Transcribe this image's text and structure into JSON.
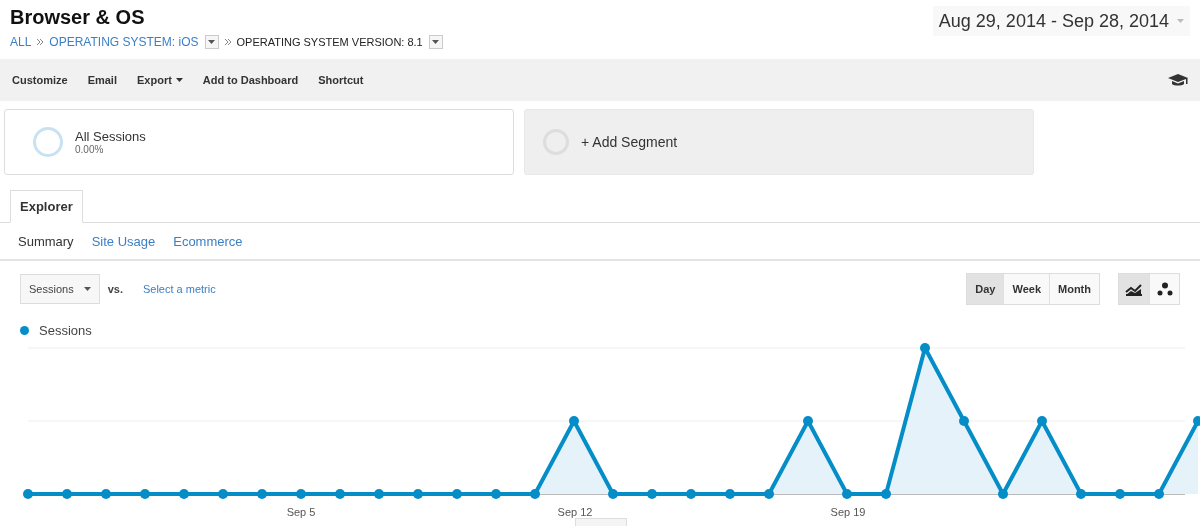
{
  "title": "Browser & OS",
  "date_range": "Aug 29, 2014 - Sep 28, 2014",
  "breadcrumb": [
    {
      "label": "ALL",
      "kind": "link"
    },
    {
      "label": "OPERATING SYSTEM: iOS",
      "kind": "dropdown"
    },
    {
      "label": "OPERATING SYSTEM VERSION: 8.1",
      "kind": "dropdown-current"
    }
  ],
  "toolbar": [
    {
      "label": "Customize",
      "menu": false
    },
    {
      "label": "Email",
      "menu": false
    },
    {
      "label": "Export",
      "menu": true
    },
    {
      "label": "Add to Dashboard",
      "menu": false
    },
    {
      "label": "Shortcut",
      "menu": false
    }
  ],
  "segments": [
    {
      "name": "All Sessions",
      "detail": "0.00%",
      "kind": "active"
    },
    {
      "name": "+ Add Segment",
      "kind": "add"
    }
  ],
  "tabs": [
    {
      "label": "Explorer",
      "selected": true
    }
  ],
  "subtabs": [
    {
      "label": "Summary",
      "selected": true
    },
    {
      "label": "Site Usage",
      "selected": false
    },
    {
      "label": "Ecommerce",
      "selected": false
    }
  ],
  "metric": {
    "value": "Sessions",
    "vs": "vs.",
    "compare": "Select a metric"
  },
  "periods": [
    {
      "label": "Day",
      "selected": true
    },
    {
      "label": "Week",
      "selected": false
    },
    {
      "label": "Month",
      "selected": false
    }
  ],
  "chart_modes": [
    {
      "kind": "line",
      "selected": true
    },
    {
      "kind": "motion",
      "selected": false
    }
  ],
  "legend": "Sessions",
  "x_labels": [
    "Sep 5",
    "Sep 12",
    "Sep 19"
  ]
}
